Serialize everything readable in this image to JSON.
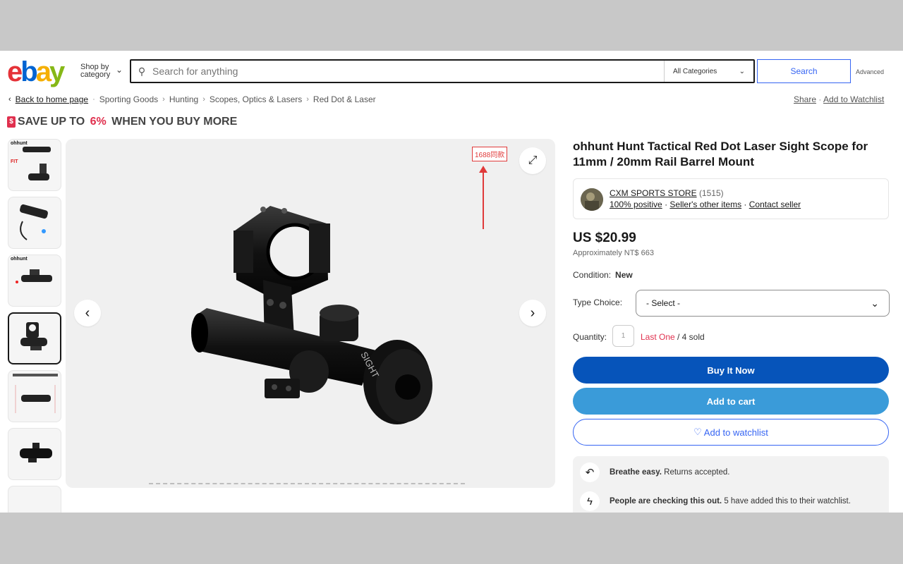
{
  "header": {
    "logo": {
      "e": "e",
      "b": "b",
      "a": "a",
      "y": "y"
    },
    "shop_by_category": {
      "line1": "Shop by",
      "line2": "category"
    },
    "search_placeholder": "Search for anything",
    "category_select": "All Categories",
    "search_button": "Search",
    "advanced": "Advanced"
  },
  "breadcrumb": {
    "back": "Back to home page",
    "items": [
      "Sporting Goods",
      "Hunting",
      "Scopes, Optics & Lasers",
      "Red Dot & Laser"
    ],
    "share": "Share",
    "add_to_watchlist": "Add to Watchlist"
  },
  "promo": {
    "prefix": "SAVE UP TO ",
    "percent": "6%",
    "suffix": " WHEN YOU BUY MORE",
    "tag_symbol": "$"
  },
  "gallery": {
    "badge": "1688同款",
    "thumbnail_count": 7,
    "selected_index": 3,
    "thumbnail_labels": [
      "ohhunt",
      "FIT",
      "ohhunt"
    ]
  },
  "product": {
    "title": "ohhunt Hunt Tactical Red Dot Laser Sight Scope for 11mm / 20mm Rail Barrel Mount",
    "seller": {
      "name": "CXM SPORTS STORE",
      "feedback_count": "(1515)",
      "positive": "100% positive",
      "other_items": "Seller's other items",
      "contact": "Contact seller"
    },
    "price": "US $20.99",
    "approx": "Approximately NT$ 663",
    "condition_label": "Condition:",
    "condition_value": "New",
    "type_label": "Type Choice:",
    "type_value": "- Select -",
    "quantity_label": "Quantity:",
    "quantity_value": "1",
    "last_one": "Last One",
    "sold": "/ 4 sold",
    "buy_now": "Buy It Now",
    "add_to_cart": "Add to cart",
    "add_to_watchlist": "Add to watchlist"
  },
  "info": {
    "returns_bold": "Breathe easy.",
    "returns_text": " Returns accepted.",
    "watch_bold": "People are checking this out.",
    "watch_text": " 5 have added this to their watchlist."
  },
  "colors": {
    "ebay_red": "#e53238",
    "ebay_blue": "#0064d2",
    "ebay_yellow": "#f5af02",
    "ebay_green": "#86b817",
    "buy_button": "#0654ba",
    "cart_button": "#3a9bd9",
    "link_blue": "#3665f3",
    "alert_red": "#e0304e"
  }
}
